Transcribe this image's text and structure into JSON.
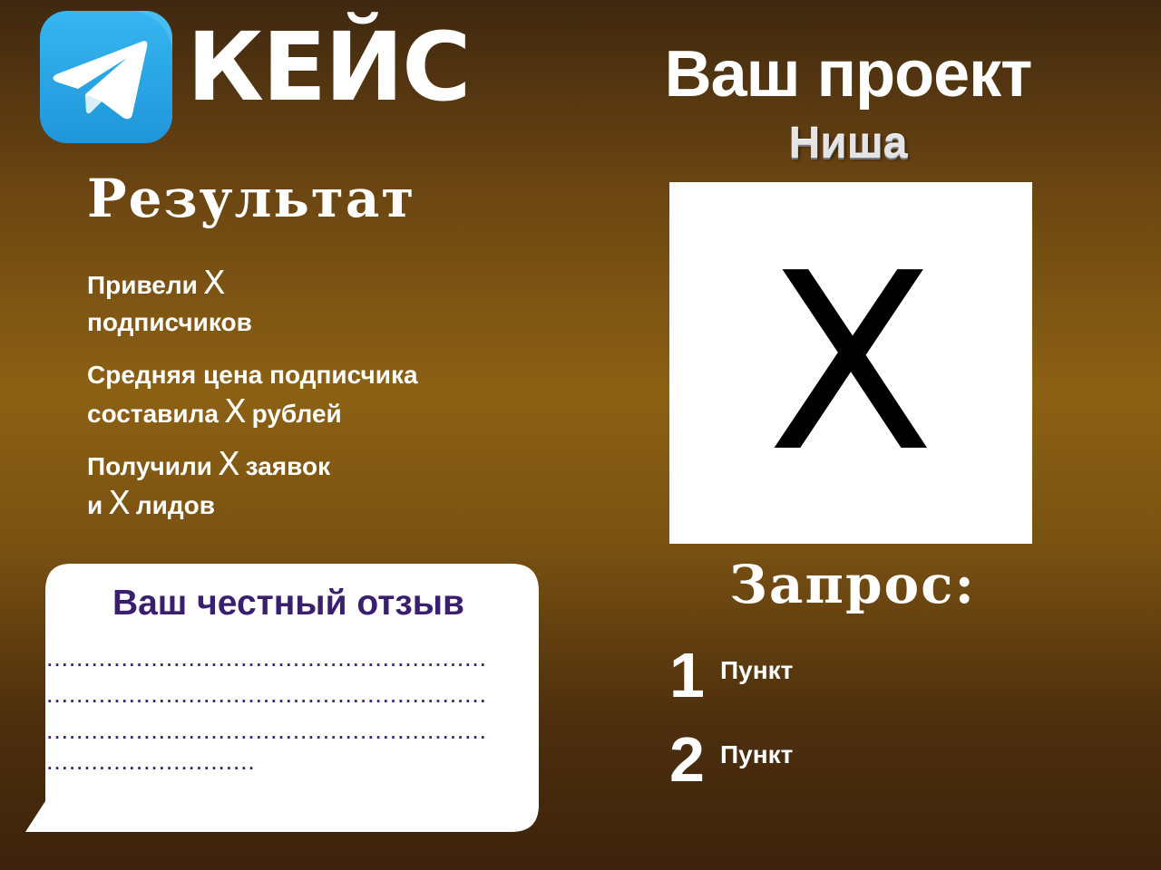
{
  "header": {
    "logo_icon": "telegram-icon",
    "title": "КЕЙС"
  },
  "result": {
    "heading": "Результат",
    "items": [
      {
        "line1_before": "Привели",
        "line1_x": "X",
        "line1_after": "",
        "line2": "подписчиков"
      },
      {
        "line1": "Средняя цена подписчика",
        "line2_before": "составила",
        "line2_x": "X",
        "line2_after": "рублей"
      },
      {
        "line1_before": "Получили",
        "line1_x": "X",
        "line1_after": "заявок",
        "line2_before": "и",
        "line2_x": "X",
        "line2_after": "лидов"
      }
    ]
  },
  "project": {
    "title": "Ваш проект",
    "niche": "Ниша",
    "image_placeholder": "X"
  },
  "request": {
    "heading": "Запрос:",
    "items": [
      {
        "number": "1",
        "label": "Пункт"
      },
      {
        "number": "2",
        "label": "Пункт"
      }
    ]
  },
  "review": {
    "title": "Ваш честный отзыв",
    "lines": [
      "...........................................................",
      "...........................................................",
      "...........................................................",
      "............................"
    ]
  },
  "colors": {
    "background_top": "#3f2810",
    "background_mid": "#8c6114",
    "background_bottom": "#3c220c",
    "review_text": "#3a1f6e",
    "telegram_blue": "#2aa8e8"
  }
}
